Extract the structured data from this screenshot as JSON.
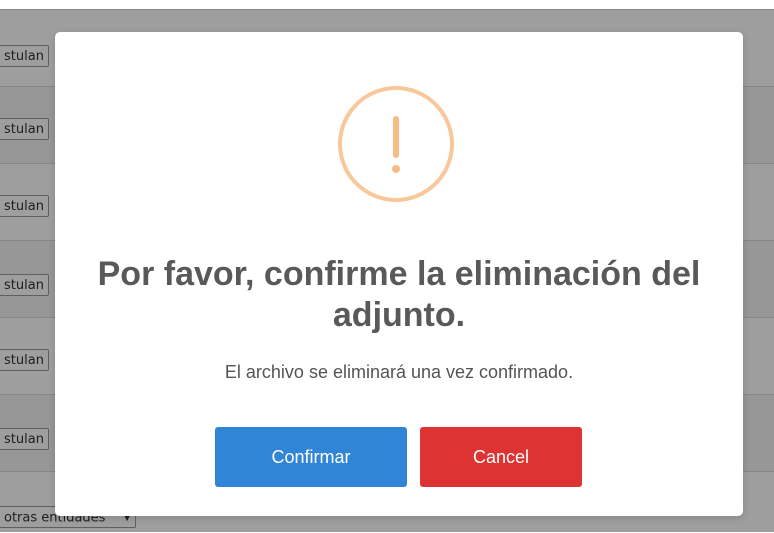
{
  "background": {
    "select_label": "stulan",
    "rows": [
      {
        "select_label": "stulan"
      },
      {
        "select_label": "stulan"
      },
      {
        "select_label": "stulan"
      },
      {
        "select_label": "stulan"
      },
      {
        "select_label": "stulan"
      },
      {
        "select_label": "stulan"
      }
    ],
    "bottom_select_label": "otras entidades"
  },
  "dialog": {
    "icon": "warning-icon",
    "icon_color": "#f8bb86",
    "title": "Por favor, confirme la eliminación del adjunto.",
    "text": "El archivo se eliminará una vez confirmado.",
    "confirm_label": "Confirmar",
    "cancel_label": "Cancel",
    "confirm_color": "#3085d6",
    "cancel_color": "#dd3333"
  }
}
